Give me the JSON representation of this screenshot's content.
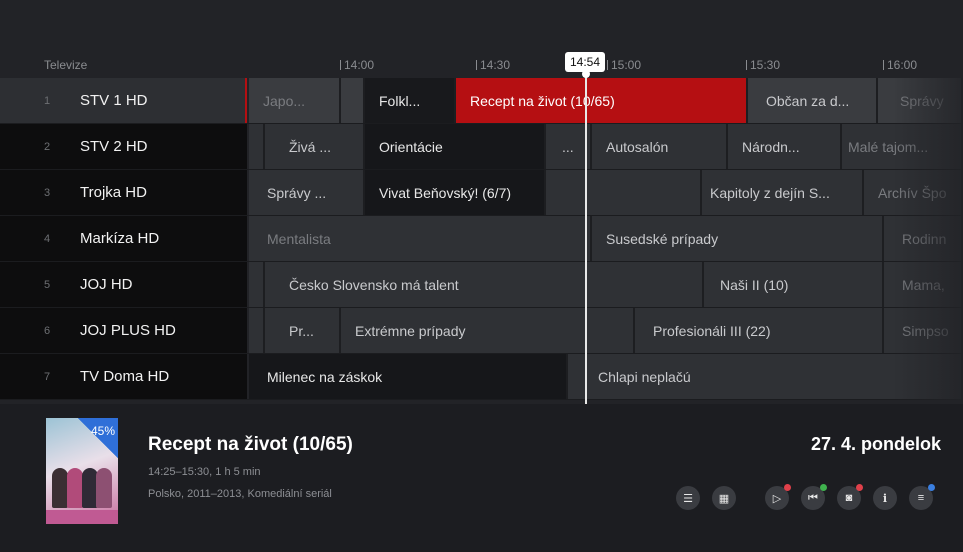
{
  "header": {
    "label": "Televize",
    "ticks": [
      "14:00",
      "14:30",
      "15:00",
      "15:30",
      "16:00"
    ],
    "now": "14:54"
  },
  "channels": [
    {
      "num": "1",
      "name": "STV 1 HD",
      "programs": [
        "Japo...",
        "",
        "Folkl...",
        "Recept na život (10/65)",
        "Občan za d...",
        "Správy"
      ]
    },
    {
      "num": "2",
      "name": "STV 2 HD",
      "programs": [
        "Živá ...",
        "Orientácie",
        "...",
        "Autosalón",
        "Národn...",
        "Malé tajom..."
      ]
    },
    {
      "num": "3",
      "name": "Trojka HD",
      "programs": [
        "Správy ...",
        "Vivat Beňovský! (6/7)",
        "Kapitoly z dejín S...",
        "Archív Špo"
      ]
    },
    {
      "num": "4",
      "name": "Markíza HD",
      "programs": [
        "Mentalista",
        "Susedské prípady",
        "Rodinn"
      ]
    },
    {
      "num": "5",
      "name": "JOJ HD",
      "programs": [
        "Česko Slovensko má talent",
        "Naši II (10)",
        "Mama,"
      ]
    },
    {
      "num": "6",
      "name": "JOJ PLUS HD",
      "programs": [
        "Pr...",
        "Extrémne prípady",
        "Profesionáli III (22)",
        "Simpso"
      ]
    },
    {
      "num": "7",
      "name": "TV Doma HD",
      "programs": [
        "Milenec na záskok",
        "Chlapi neplačú"
      ]
    }
  ],
  "details": {
    "progress_percent": "45%",
    "progress": 0.45,
    "title": "Recept na život (10/65)",
    "time": "14:25–15:30, 1 h 5 min",
    "meta": "Polsko, 2011–2013, Komediální seriál",
    "date": "27. 4. pondelok",
    "buttons": [
      {
        "icon": "list-icon",
        "dot": ""
      },
      {
        "icon": "calendar-icon",
        "dot": ""
      },
      {
        "icon": "play-icon",
        "dot": "#e0404a"
      },
      {
        "icon": "restart-icon",
        "dot": "#3fb24e"
      },
      {
        "icon": "record-icon",
        "dot": "#e0404a"
      },
      {
        "icon": "info-icon",
        "dot": ""
      },
      {
        "icon": "menu-icon",
        "dot": "#3a7fe0"
      }
    ]
  },
  "colors": {
    "selected": "#b50f12",
    "accent_blue": "#2f6fd8"
  }
}
